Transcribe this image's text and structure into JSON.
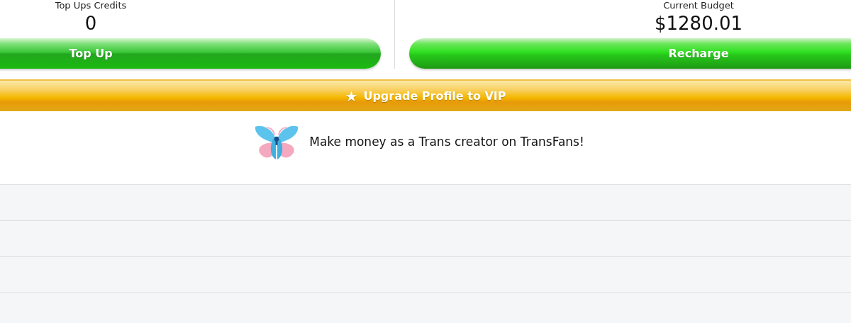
{
  "balances": [
    {
      "label": "Top Ups Credits",
      "value": "0",
      "button": "Top Up"
    },
    {
      "label": "Current Budget",
      "value": "$1280.01",
      "button": "Recharge"
    }
  ],
  "vip_button": {
    "icon": "★",
    "label": "Upgrade Profile to VIP"
  },
  "promo": {
    "text": "Make money as a Trans creator on TransFans!"
  }
}
